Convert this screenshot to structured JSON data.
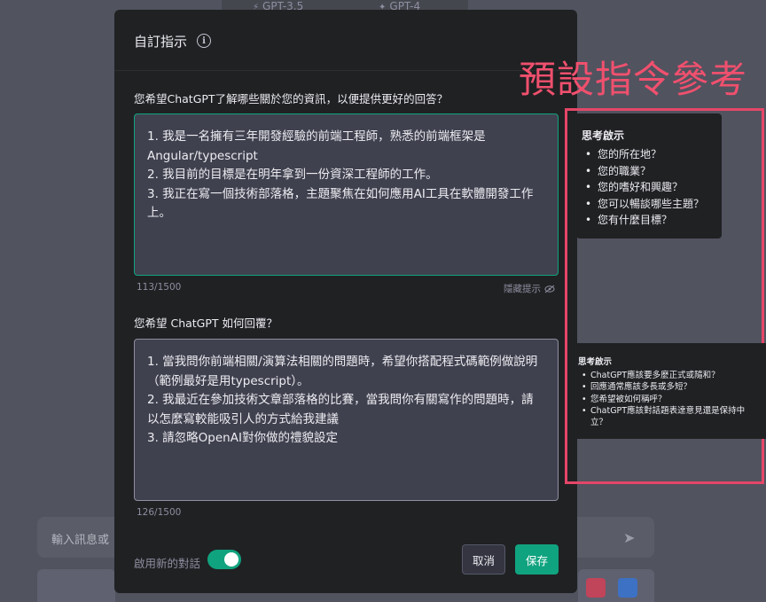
{
  "background": {
    "tabs": [
      {
        "label": "GPT-3.5",
        "icon": "bolt-icon"
      },
      {
        "label": "GPT-4",
        "icon": "sparkle-icon"
      }
    ],
    "input_placeholder": "輸入訊息或"
  },
  "modal": {
    "title": "自訂指示",
    "question1": "您希望ChatGPT了解哪些關於您的資訊，以便提供更好的回答？",
    "answer1": "1. 我是一名擁有三年開發經驗的前端工程師，熟悉的前端框架是Angular/typescript\n2. 我目前的目標是在明年拿到一份資深工程師的工作。\n3. 我正在寫一個技術部落格，主題聚焦在如何應用AI工具在軟體開發工作上。",
    "counter1": "113/1500",
    "hide_tips": "隱藏提示",
    "question2": "您希望 ChatGPT 如何回覆？",
    "answer2": "1. 當我問你前端相關/演算法相關的問題時，希望你搭配程式碼範例做說明（範例最好是用typescript）。\n2. 我最近在參加技術文章部落格的比賽，當我問你有關寫作的問題時，請以怎麼寫較能吸引人的方式給我建議\n3. 請忽略OpenAI對你做的禮貌設定",
    "counter2": "126/1500",
    "enable_new_chat": "啟用新的對話",
    "toggle_on": true,
    "cancel": "取消",
    "save": "保存"
  },
  "annotation": {
    "title": "預設指令參考",
    "color": "#e54668"
  },
  "tip1": {
    "title": "思考啟示",
    "items": [
      "您的所在地？",
      "您的職業？",
      "您的嗜好和興趣？",
      "您可以暢談哪些主題？",
      "您有什麼目標？"
    ]
  },
  "tip2": {
    "title": "思考啟示",
    "items": [
      "ChatGPT應該要多麼正式或隨和？",
      "回應通常應該多長或多短？",
      "您希望被如何稱呼？",
      "ChatGPT應該對話題表達意見還是保持中立？"
    ]
  },
  "colors": {
    "accent": "#10a37f",
    "modal_bg": "#202123",
    "field_bg": "#40414f"
  }
}
